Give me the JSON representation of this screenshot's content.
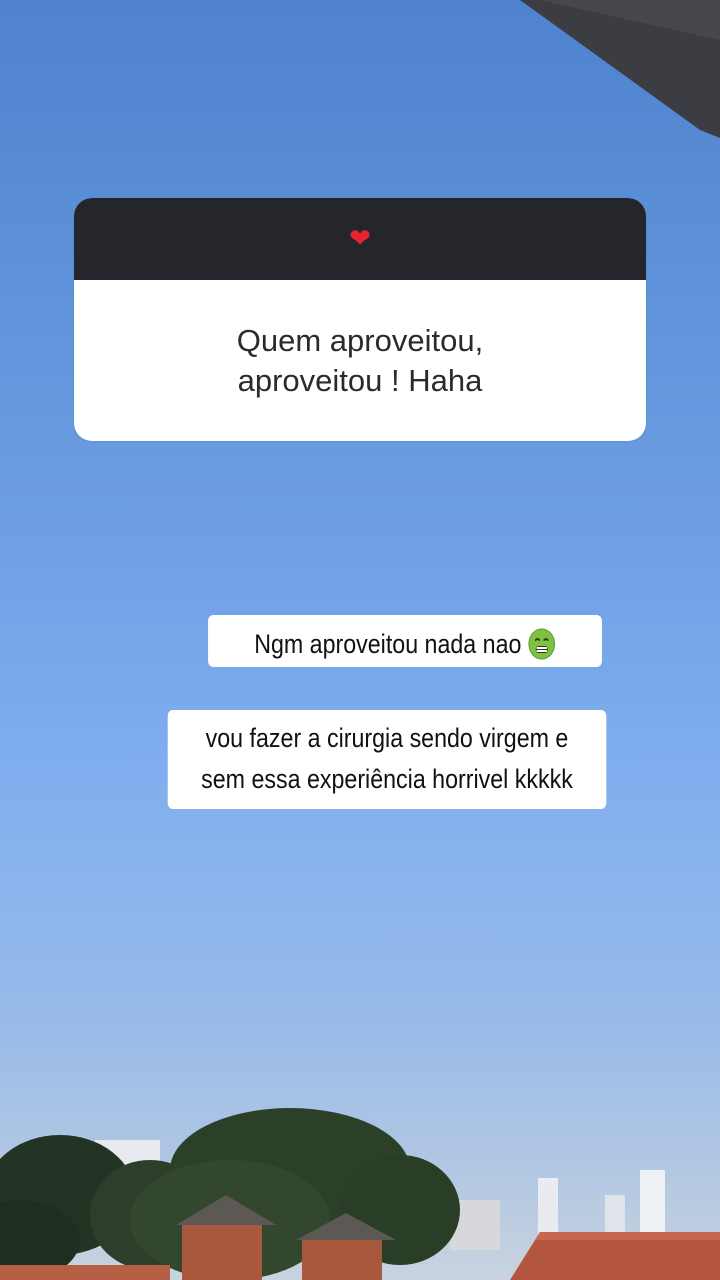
{
  "question_sticker": {
    "header_icon": "red-heart-icon",
    "header_glyph": "❤",
    "answer_text": "Quem aproveitou,\naproveitou ! Haha"
  },
  "replies": {
    "line_one": "Ngm aproveitou nada nao",
    "line_one_icon": "nauseated-face-icon",
    "line_two": "vou fazer a cirurgia sendo virgem e\nsem essa experiência horrivel kkkkk"
  },
  "colors": {
    "sticker_header": "#25262b",
    "sticker_body": "#ffffff",
    "sky_top": "#4f82cf",
    "sky_bottom": "#c9d3df",
    "heart": "#e8242f",
    "nauseated_face": "#7cc142"
  }
}
